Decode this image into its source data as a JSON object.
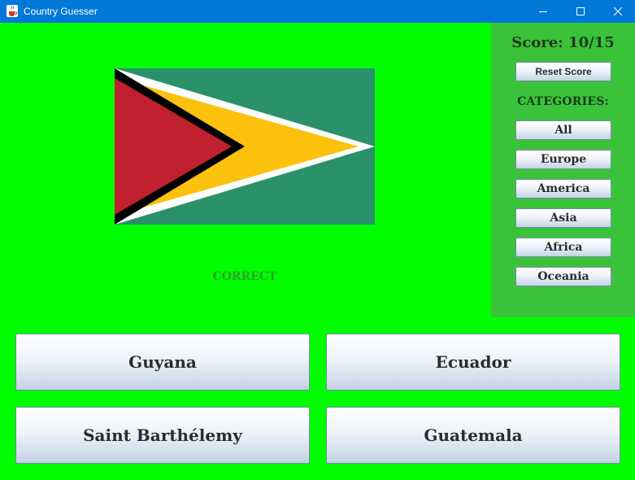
{
  "window": {
    "title": "Country Guesser",
    "icon": "java-cup-icon"
  },
  "window_controls": {
    "minimize_icon": "minimize-icon",
    "maximize_icon": "maximize-icon",
    "close_icon": "close-icon"
  },
  "flag": {
    "country": "Guyana",
    "colors": {
      "field": "#2a916a",
      "arrow": "#fcc10c",
      "border_white": "#ffffff",
      "border_black": "#000000",
      "triangle": "#c1202f"
    }
  },
  "feedback": {
    "text": "CORRECT",
    "color": "#27a327"
  },
  "side_panel": {
    "score_text": "Score: 10/15",
    "reset_label": "Reset Score",
    "categories_label": "CATEGORIES:",
    "categories": [
      "All",
      "Europe",
      "America",
      "Asia",
      "Africa",
      "Oceania"
    ]
  },
  "answers": [
    "Guyana",
    "Ecuador",
    "Saint Barthélemy",
    "Guatemala"
  ],
  "colors": {
    "background": "#00ff00",
    "panel": "#3ac33a",
    "titlebar": "#0078d7"
  }
}
